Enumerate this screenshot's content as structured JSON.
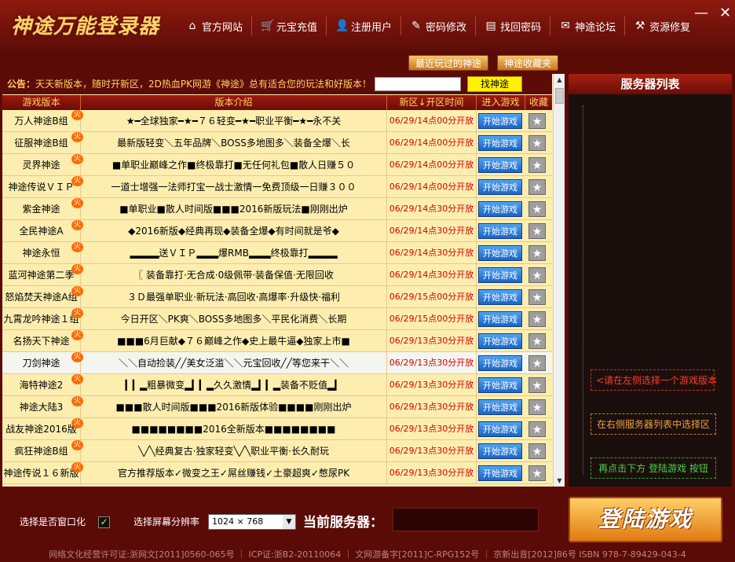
{
  "header": {
    "logo": "神途万能登录器",
    "nav": [
      {
        "icon": "home-icon",
        "glyph": "⌂",
        "label": "官方网站"
      },
      {
        "icon": "cart-icon",
        "glyph": "🛒",
        "label": "元宝充值"
      },
      {
        "icon": "user-icon",
        "glyph": "👤",
        "label": "注册用户"
      },
      {
        "icon": "pen-icon",
        "glyph": "✎",
        "label": "密码修改"
      },
      {
        "icon": "document-icon",
        "glyph": "▤",
        "label": "找回密码"
      },
      {
        "icon": "chat-icon",
        "glyph": "✉",
        "label": "神途论坛"
      },
      {
        "icon": "tools-icon",
        "glyph": "⚒",
        "label": "资源修复"
      }
    ],
    "minimize": "—",
    "close": "✕"
  },
  "subtabs": {
    "recent": "最近玩过的神途",
    "favorites": "神途收藏夹"
  },
  "notice": {
    "label": "公告：",
    "text": "天天新版本，随时开新区，2D热血PK网游《神途》总有适合您的玩法和好版本！",
    "search_button": "找神途"
  },
  "table": {
    "headers": {
      "name": "游戏版本",
      "desc": "版本介绍",
      "time": "新区↓开区时间",
      "play": "进入游戏",
      "fav": "收藏"
    },
    "play_label": "开始游戏",
    "fav_glyph": "★",
    "hot_glyph": "火",
    "rows": [
      {
        "name": "万人神途B组",
        "desc": "★━全球独家━★━７６轻变━★━职业平衡━★━永不关",
        "time": "06/29/14点00分开放"
      },
      {
        "name": "征服神途B组",
        "desc": "最新版轻变＼五年品牌＼BOSS多地图多＼装备全爆＼长",
        "time": "06/29/14点00分开放"
      },
      {
        "name": "灵界神途",
        "desc": "■单职业巅峰之作■终极靠打■无任何礼包■散人日赚５０",
        "time": "06/29/14点00分开放"
      },
      {
        "name": "神途传说ＶＩＰ",
        "desc": "一道士增强一法师打宝一战士激情一免费顶级一日赚３００",
        "time": "06/29/14点00分开放"
      },
      {
        "name": "紫金神途",
        "desc": "■单职业■散人时间版■■■2016新版玩法■刚刚出炉",
        "time": "06/29/14点30分开放"
      },
      {
        "name": "全民神途A",
        "desc": "◆2016新版◆经典再现◆装备全爆◆有时间就是爷◆",
        "time": "06/29/14点30分开放"
      },
      {
        "name": "神途永恒",
        "desc": "▂▂▂▂送ＶＩＰ▂▂▂爆RMB▂▂▂终极靠打▂▂▂▂",
        "time": "06/29/14点30分开放"
      },
      {
        "name": "蓝河神途第二季",
        "desc": "〖 装备靠打·无合成·0级佩带·装备保值·无限回收",
        "time": "06/29/14点30分开放"
      },
      {
        "name": "怒焰焚天神途A组",
        "desc": "３Ｄ最强单职业·新玩法·高回收·高爆率·升级快·福利",
        "time": "06/29/15点00分开放"
      },
      {
        "name": "九霄龙吟神途１组",
        "desc": "今日开区＼PK爽＼BOSS多地图多＼平民化消费＼长期",
        "time": "06/29/15点00分开放"
      },
      {
        "name": "名扬天下神途",
        "desc": "■■■6月巨献◆７６巅峰之作◆史上最牛逼◆独家上市■",
        "time": "06/29/13点30分开放"
      },
      {
        "name": "刀剑神途",
        "desc": "＼＼自动捡装╱╱美女泛滥＼＼元宝回收╱╱等您来干＼＼",
        "time": "06/29/13点30分开放"
      },
      {
        "name": "海特神途2",
        "desc": "▎▎▂粗暴微变▂▎▎▂久久激情▂▎▎▂装备不贬值▂▎",
        "time": "06/29/13点30分开放"
      },
      {
        "name": "神途大陆3",
        "desc": "■■■散人时间版■■■2016新版体验■■■■刚刚出炉",
        "time": "06/29/13点30分开放"
      },
      {
        "name": "战友神途2016版",
        "desc": "■■■■■■■■2016全新版本■■■■■■■■",
        "time": "06/29/13点30分开放"
      },
      {
        "name": "疯狂神途B组",
        "desc": "╲╱╲经典复古·独家轻变╲╱╲职业平衡·长久耐玩",
        "time": "06/29/13点30分开放"
      },
      {
        "name": "神途传说１６新版",
        "desc": "官方推荐版本✓微变之王✓屌丝赚钱✓土豪超爽✓憋尿PK",
        "time": "06/29/13点30分开放"
      }
    ]
  },
  "right_panel": {
    "title": "服务器列表",
    "hint_1": "<请在左侧选择一个游戏版本",
    "hint_2": "在右侧服务器列表中选择区",
    "hint_3": "再点击下方 登陆游戏 按钮"
  },
  "bottom": {
    "window_mode_label": "选择是否窗口化",
    "window_mode_checked": "✓",
    "resolution_label": "选择屏幕分辨率",
    "resolution_value": "1024 × 768",
    "current_server_label": "当前服务器：",
    "login_button": "登陆游戏"
  },
  "footer": "网络文化经营许可证:浙网文[2011]0560-065号 ｜ ICP证:浙B2-20110064 ｜ 文网游备字[2011]C-RPG152号 ｜ 京新出音[2012]86号 ISBN 978-7-89429-043-4",
  "colors": {
    "accent_red": "#8e1a0f",
    "time_red": "#d40000",
    "play_blue": "#1a64c8",
    "gold": "#ffd36b"
  }
}
